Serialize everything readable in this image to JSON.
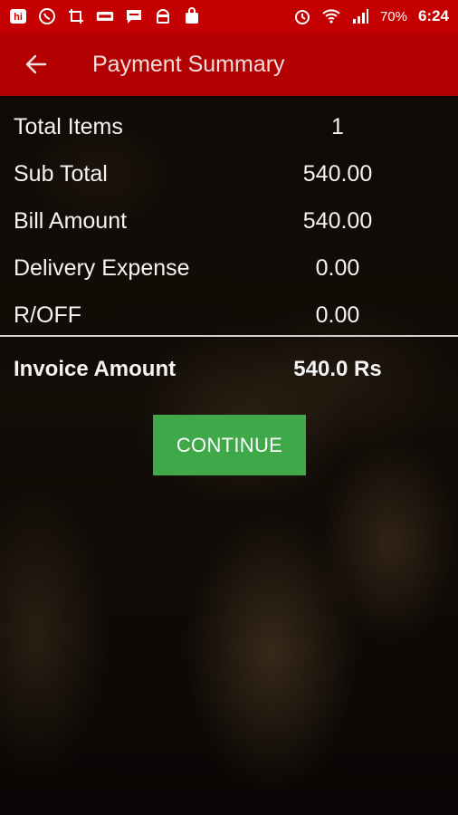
{
  "status_bar": {
    "battery": "70%",
    "time": "6:24",
    "icons": [
      "hi-app-icon",
      "whatsapp-icon",
      "crop-icon",
      "data-usage-icon",
      "message-icon",
      "android-icon",
      "shopping-bag-icon",
      "alarm-icon",
      "wifi-icon",
      "signal-icon"
    ]
  },
  "app_bar": {
    "title": "Payment Summary",
    "back_icon": "arrow-left-icon"
  },
  "summary": {
    "rows": [
      {
        "label": "Total Items",
        "value": "1"
      },
      {
        "label": "Sub Total",
        "value": "540.00"
      },
      {
        "label": "Bill Amount",
        "value": "540.00"
      },
      {
        "label": "Delivery Expense",
        "value": "0.00"
      },
      {
        "label": "R/OFF",
        "value": "0.00"
      }
    ],
    "invoice": {
      "label": "Invoice Amount",
      "value": "540.0 Rs"
    }
  },
  "actions": {
    "continue_label": "CONTINUE"
  },
  "colors": {
    "status_bar": "#c40000",
    "app_bar": "#b30000",
    "continue_button": "#3fa848"
  }
}
